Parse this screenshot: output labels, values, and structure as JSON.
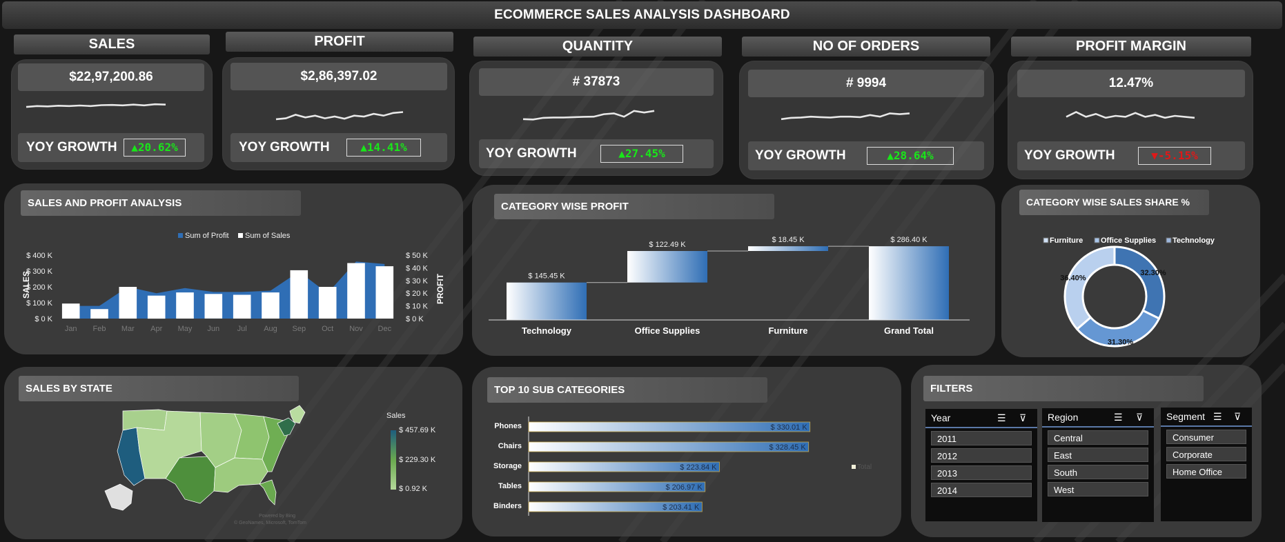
{
  "title": "ECOMMERCE SALES ANALYSIS DASHBOARD",
  "kpis": [
    {
      "label": "SALES",
      "value": "$22,97,200.86",
      "yoy_label": "YOY GROWTH",
      "yoy": "▲20.62%",
      "trend": "up",
      "spark": [
        0.35,
        0.3,
        0.32,
        0.28,
        0.3,
        0.27,
        0.3,
        0.25,
        0.24,
        0.26,
        0.22,
        0.26,
        0.2,
        0.22
      ]
    },
    {
      "label": "PROFIT",
      "value": "$2,86,397.02",
      "yoy_label": "YOY GROWTH",
      "yoy": "▲14.41%",
      "trend": "up",
      "spark": [
        0.65,
        0.6,
        0.4,
        0.55,
        0.45,
        0.6,
        0.5,
        0.62,
        0.45,
        0.5,
        0.35,
        0.45,
        0.3,
        0.25
      ]
    },
    {
      "label": "QUANTITY",
      "value": "# 37873",
      "yoy_label": "YOY GROWTH",
      "yoy": "▲27.45%",
      "trend": "up",
      "spark": [
        0.7,
        0.72,
        0.62,
        0.6,
        0.6,
        0.58,
        0.56,
        0.55,
        0.4,
        0.35,
        0.55,
        0.2,
        0.3,
        0.2
      ]
    },
    {
      "label": "NO OF ORDERS",
      "value": "# 9994",
      "yoy_label": "YOY GROWTH",
      "yoy": "▲28.64%",
      "trend": "up",
      "spark": [
        0.7,
        0.62,
        0.6,
        0.55,
        0.58,
        0.6,
        0.55,
        0.55,
        0.58,
        0.45,
        0.55,
        0.35,
        0.4,
        0.35
      ]
    },
    {
      "label": "PROFIT MARGIN",
      "value": "12.47%",
      "yoy_label": "YOY GROWTH",
      "yoy": "▼-5.15%",
      "trend": "down",
      "spark": [
        0.55,
        0.3,
        0.55,
        0.4,
        0.6,
        0.5,
        0.55,
        0.35,
        0.55,
        0.45,
        0.6,
        0.5,
        0.55,
        0.6
      ]
    }
  ],
  "sales_profit": {
    "title": "SALES AND PROFIT ANALYSIS",
    "legend_profit": "Sum of Profit",
    "legend_sales": "Sum of Sales",
    "ylabel_left": "SALES",
    "ylabel_right": "PROFIT",
    "left_ticks": [
      "$ 400 K",
      "$ 300 K",
      "$ 200 K",
      "$ 100 K",
      "$ 0 K"
    ],
    "right_ticks": [
      "$ 50 K",
      "$ 40 K",
      "$ 30 K",
      "$ 20 K",
      "$ 10 K",
      "$ 0 K"
    ]
  },
  "category_profit": {
    "title": "CATEGORY WISE PROFIT",
    "bars": [
      {
        "label": "Technology",
        "value": "$ 145.45 K"
      },
      {
        "label": "Office Supplies",
        "value": "$ 122.49 K"
      },
      {
        "label": "Furniture",
        "value": "$ 18.45 K"
      },
      {
        "label": "Grand Total",
        "value": "$ 286.40 K"
      }
    ]
  },
  "category_share": {
    "title": "CATEGORY WISE SALES SHARE %",
    "legend": [
      "Furniture",
      "Office Supplies",
      "Technology"
    ],
    "labels": {
      "technology": "32.30%",
      "office": "31.30%",
      "furniture": "36.40%"
    }
  },
  "sales_by_state": {
    "title": "SALES BY STATE",
    "legend_title": "Sales",
    "legend_max": "$ 457.69 K",
    "legend_mid": "$ 229.30 K",
    "legend_min": "$ 0.92 K",
    "credit_1": "Powered by Bing",
    "credit_2": "© GeoNames, Microsoft, TomTom"
  },
  "top_sub": {
    "title": "TOP 10 SUB CATEGORIES",
    "legend": "Total",
    "bars": [
      {
        "label": "Phones",
        "value": "$ 330.01 K"
      },
      {
        "label": "Chairs",
        "value": "$ 328.45 K"
      },
      {
        "label": "Storage",
        "value": "$ 223.84 K"
      },
      {
        "label": "Tables",
        "value": "$ 206.97 K"
      },
      {
        "label": "Binders",
        "value": "$ 203.41 K"
      }
    ]
  },
  "filters": {
    "title": "FILTERS",
    "year": {
      "label": "Year",
      "items": [
        "2011",
        "2012",
        "2013",
        "2014"
      ]
    },
    "region": {
      "label": "Region",
      "items": [
        "Central",
        "East",
        "South",
        "West"
      ]
    },
    "segment": {
      "label": "Segment",
      "items": [
        "Consumer",
        "Corporate",
        "Home Office"
      ]
    }
  },
  "chart_data": [
    {
      "type": "bar",
      "title": "SALES AND PROFIT ANALYSIS",
      "categories": [
        "Jan",
        "Feb",
        "Mar",
        "Apr",
        "May",
        "Jun",
        "Jul",
        "Aug",
        "Sep",
        "Oct",
        "Nov",
        "Dec"
      ],
      "series": [
        {
          "name": "Sum of Sales",
          "type": "bar",
          "axis": "left",
          "values": [
            95000,
            60000,
            200000,
            145000,
            165000,
            155000,
            150000,
            165000,
            305000,
            200000,
            350000,
            330000
          ]
        },
        {
          "name": "Sum of Profit",
          "type": "area",
          "axis": "right",
          "values": [
            10000,
            10000,
            25000,
            20000,
            24000,
            21000,
            21000,
            22000,
            37000,
            20000,
            45000,
            43000
          ]
        }
      ],
      "ylabel": "SALES",
      "y2label": "PROFIT",
      "ylim": [
        0,
        400000
      ],
      "y2lim": [
        0,
        50000
      ],
      "legend": "top-center"
    },
    {
      "type": "bar",
      "title": "CATEGORY WISE PROFIT",
      "subtype": "waterfall",
      "categories": [
        "Technology",
        "Office Supplies",
        "Furniture",
        "Grand Total"
      ],
      "values": [
        145.45,
        122.49,
        18.45,
        286.4
      ],
      "unit": "$ K"
    },
    {
      "type": "pie",
      "title": "CATEGORY WISE SALES SHARE %",
      "categories": [
        "Technology",
        "Office Supplies",
        "Furniture"
      ],
      "values": [
        32.3,
        31.3,
        36.4
      ]
    },
    {
      "type": "bar",
      "title": "TOP 10 SUB CATEGORIES",
      "orientation": "horizontal",
      "categories": [
        "Phones",
        "Chairs",
        "Storage",
        "Tables",
        "Binders"
      ],
      "values": [
        330.01,
        328.45,
        223.84,
        206.97,
        203.41
      ],
      "unit": "$ K",
      "legend": "right"
    }
  ],
  "colors": {
    "accent_blue": "#2f6eb5",
    "up": "#19e619",
    "down": "#e01818",
    "map_dark": "#1e5d7e",
    "map_light": "#a8d08d"
  }
}
